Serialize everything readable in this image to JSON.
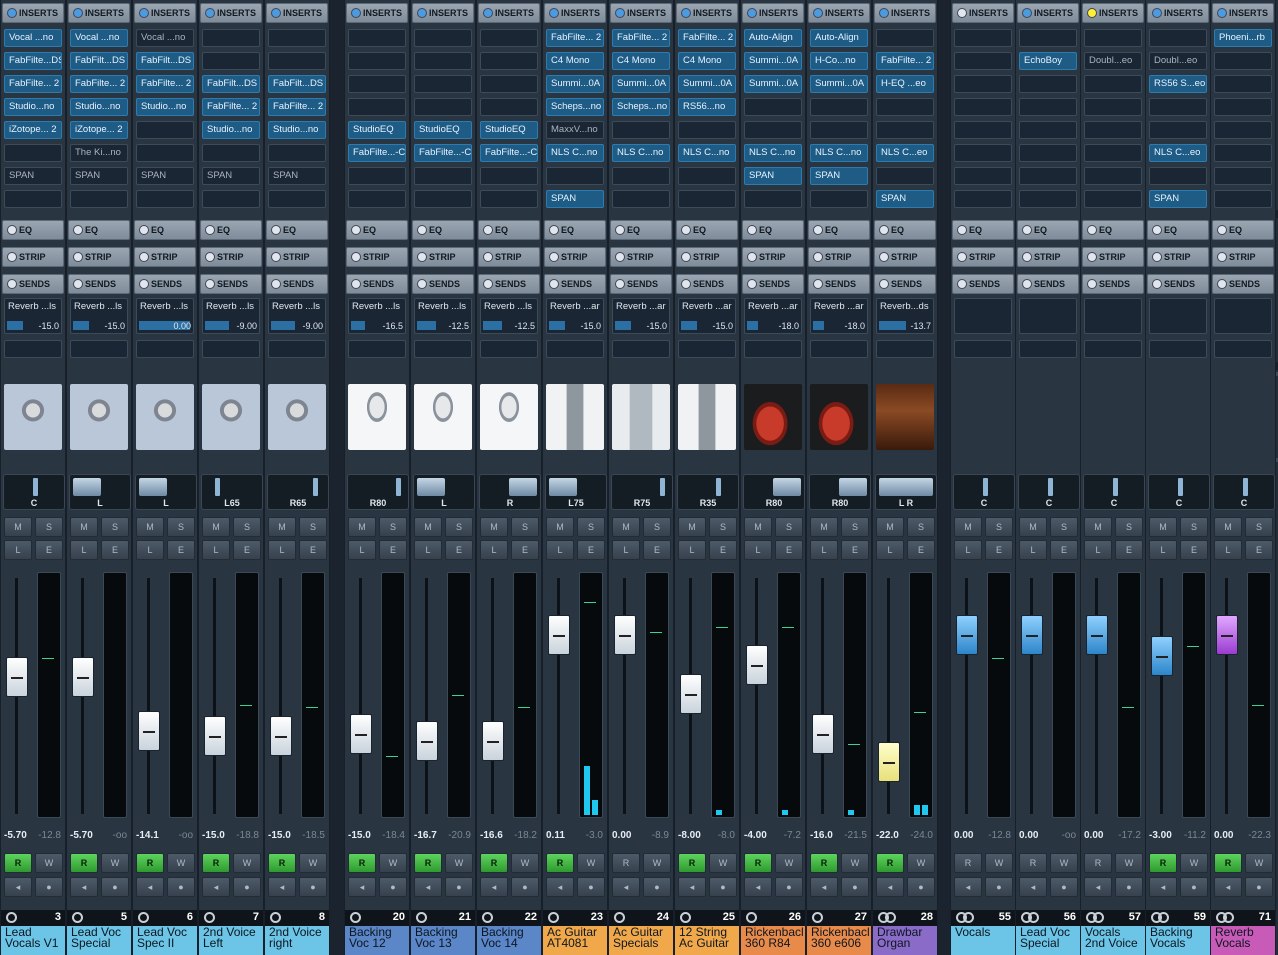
{
  "colors": {
    "rec_green": "#4ec24e",
    "insert_blue": "#1f5c85",
    "accent_yellow": "#ffee33"
  },
  "labels": {
    "inserts": "INSERTS",
    "eq": "EQ",
    "strip": "STRIP",
    "sends": "SENDS",
    "mute": "M",
    "solo": "S",
    "listen": "L",
    "edit": "E",
    "read": "R",
    "write": "W"
  },
  "strips": [
    {
      "num": "3",
      "name": "Lead Vocals V1",
      "color": "#6cc4e6",
      "inserts": [
        "Vocal ...no",
        "FabFilte...DS",
        "FabFilte... 2",
        "Studio...no",
        "iZotope... 2",
        "",
        "SPAN",
        ""
      ],
      "insert_on": [
        1,
        1,
        1,
        1,
        1,
        0,
        0,
        0
      ],
      "send_name": "Reverb ...ls",
      "send_val": "-15.0",
      "send_frac": 0.3,
      "pan": "C",
      "pan_pos": 0.5,
      "pan_mode": "ind",
      "vol": "-5.70",
      "peak": "-12.8",
      "fader": 0.42,
      "cap": "white",
      "rec": true,
      "pic": "mic-large",
      "link": false,
      "meter_peak": 0.65
    },
    {
      "num": "5",
      "name": "Lead Voc Special",
      "color": "#6cc4e6",
      "inserts": [
        "Vocal ...no",
        "FabFilt...DS",
        "FabFilte... 2",
        "Studio...no",
        "iZotope... 2",
        "The Ki...no",
        "SPAN",
        ""
      ],
      "insert_on": [
        1,
        1,
        1,
        1,
        1,
        0,
        0,
        0
      ],
      "send_name": "Reverb ...ls",
      "send_val": "-15.0",
      "send_frac": 0.3,
      "pan": "L",
      "pan_pos": 0.0,
      "pan_mode": "wideL",
      "vol": "-5.70",
      "peak": "-oo",
      "fader": 0.42,
      "cap": "white",
      "rec": true,
      "pic": "mic-large",
      "link": false,
      "meter_peak": 0.0
    },
    {
      "num": "6",
      "name": "Lead Voc Spec II",
      "color": "#6cc4e6",
      "inserts": [
        "Vocal ...no",
        "FabFilt...DS",
        "FabFilte... 2",
        "Studio...no",
        "",
        "",
        "SPAN",
        ""
      ],
      "insert_on": [
        0,
        1,
        1,
        1,
        0,
        0,
        0,
        0
      ],
      "send_name": "Reverb ...ls",
      "send_val": "0.00",
      "send_frac": 0.95,
      "pan": "L",
      "pan_pos": 0.0,
      "pan_mode": "wideL",
      "vol": "-14.1",
      "peak": "-oo",
      "fader": 0.65,
      "cap": "white",
      "rec": true,
      "pic": "mic-large",
      "link": false,
      "meter_peak": 0.0
    },
    {
      "num": "7",
      "name": "2nd Voice Left",
      "color": "#6cc4e6",
      "inserts": [
        "",
        "",
        "FabFilt...DS",
        "FabFilte... 2",
        "Studio...no",
        "",
        "SPAN",
        ""
      ],
      "insert_on": [
        0,
        0,
        1,
        1,
        1,
        0,
        0,
        0
      ],
      "send_name": "Reverb ...ls",
      "send_val": "-9.00",
      "send_frac": 0.45,
      "pan": "L65",
      "pan_pos": 0.18,
      "pan_mode": "ind",
      "vol": "-15.0",
      "peak": "-18.8",
      "fader": 0.67,
      "cap": "white",
      "rec": true,
      "pic": "mic-large",
      "link": false,
      "meter_peak": 0.46
    },
    {
      "num": "8",
      "name": "2nd Voice right",
      "color": "#6cc4e6",
      "inserts": [
        "",
        "",
        "FabFilt...DS",
        "FabFilte... 2",
        "Studio...no",
        "",
        "SPAN",
        ""
      ],
      "insert_on": [
        0,
        0,
        1,
        1,
        1,
        0,
        0,
        0
      ],
      "send_name": "Reverb ...ls",
      "send_val": "-9.00",
      "send_frac": 0.45,
      "pan": "R65",
      "pan_pos": 0.82,
      "pan_mode": "ind",
      "vol": "-15.0",
      "peak": "-18.5",
      "fader": 0.67,
      "cap": "white",
      "rec": true,
      "pic": "mic-large",
      "link": false,
      "meter_peak": 0.45
    },
    {
      "num": "20",
      "name": "Backing Voc 12",
      "color": "#5b86c8",
      "inserts": [
        "",
        "",
        "",
        "",
        "StudioEQ",
        "FabFilte...-C",
        "",
        ""
      ],
      "insert_on": [
        0,
        0,
        0,
        0,
        1,
        1,
        0,
        0
      ],
      "send_name": "Reverb ...ls",
      "send_val": "-16.5",
      "send_frac": 0.25,
      "pan": "R80",
      "pan_pos": 0.88,
      "pan_mode": "ind",
      "vol": "-15.0",
      "peak": "-18.4",
      "fader": 0.66,
      "cap": "white",
      "rec": true,
      "pic": "mic-condenser",
      "link": false,
      "meter_peak": 0.25
    },
    {
      "num": "21",
      "name": "Backing Voc 13",
      "color": "#5b86c8",
      "inserts": [
        "",
        "",
        "",
        "",
        "StudioEQ",
        "FabFilte...-C",
        "",
        ""
      ],
      "insert_on": [
        0,
        0,
        0,
        0,
        1,
        1,
        0,
        0
      ],
      "send_name": "Reverb ...ls",
      "send_val": "-12.5",
      "send_frac": 0.35,
      "pan": "L",
      "pan_pos": 0.0,
      "pan_mode": "wideL",
      "vol": "-16.7",
      "peak": "-20.9",
      "fader": 0.69,
      "cap": "white",
      "rec": true,
      "pic": "mic-condenser",
      "link": false,
      "meter_peak": 0.5
    },
    {
      "num": "22",
      "name": "Backing Voc 14",
      "color": "#5b86c8",
      "inserts": [
        "",
        "",
        "",
        "",
        "StudioEQ",
        "FabFilte...-C",
        "",
        ""
      ],
      "insert_on": [
        0,
        0,
        0,
        0,
        1,
        1,
        0,
        0
      ],
      "send_name": "Reverb ...ls",
      "send_val": "-12.5",
      "send_frac": 0.35,
      "pan": "R",
      "pan_pos": 1.0,
      "pan_mode": "wideR",
      "vol": "-16.6",
      "peak": "-18.2",
      "fader": 0.69,
      "cap": "white",
      "rec": true,
      "pic": "mic-condenser",
      "link": false,
      "meter_peak": 0.45
    },
    {
      "num": "23",
      "name": "Ac Guitar AT4081",
      "color": "#f0a84a",
      "inserts": [
        "FabFilte... 2",
        "C4 Mono",
        "Summi...0A",
        "Scheps...no",
        "MaxxV...no",
        "NLS C...no",
        "",
        "SPAN"
      ],
      "insert_on": [
        1,
        1,
        1,
        1,
        0,
        1,
        0,
        1
      ],
      "send_name": "Reverb ...ar",
      "send_val": "-15.0",
      "send_frac": 0.3,
      "pan": "L75",
      "pan_pos": 0.12,
      "pan_mode": "wideL",
      "vol": "0.11",
      "peak": "-3.0",
      "fader": 0.24,
      "cap": "white",
      "rec": true,
      "pic": "ribbon",
      "link": false,
      "meter_peak": 0.88,
      "meter_level": [
        0.2,
        0.06
      ]
    },
    {
      "num": "24",
      "name": "Ac Guitar Specials",
      "color": "#f0a84a",
      "inserts": [
        "FabFilte... 2",
        "C4 Mono",
        "Summi...0A",
        "Scheps...no",
        "",
        "NLS C...no",
        "",
        ""
      ],
      "insert_on": [
        1,
        1,
        1,
        1,
        0,
        1,
        0,
        0
      ],
      "send_name": "Reverb ...ar",
      "send_val": "-15.0",
      "send_frac": 0.3,
      "pan": "R75",
      "pan_pos": 0.88,
      "pan_mode": "ind",
      "vol": "0.00",
      "peak": "-8.9",
      "fader": 0.24,
      "cap": "white",
      "rec": false,
      "pic": "mic-silver",
      "link": false,
      "meter_peak": 0.76
    },
    {
      "num": "25",
      "name": "12 String Ac Guitar",
      "color": "#f0a84a",
      "inserts": [
        "FabFilte... 2",
        "C4 Mono",
        "Summi...0A",
        "RS56...no",
        "",
        "NLS C...no",
        "",
        ""
      ],
      "insert_on": [
        1,
        1,
        1,
        1,
        0,
        1,
        0,
        0
      ],
      "send_name": "Reverb ...ar",
      "send_val": "-15.0",
      "send_frac": 0.3,
      "pan": "R35",
      "pan_pos": 0.68,
      "pan_mode": "ind",
      "vol": "-8.00",
      "peak": "-8.0",
      "fader": 0.49,
      "cap": "white",
      "rec": true,
      "pic": "ribbon",
      "link": false,
      "meter_peak": 0.78,
      "meter_level": [
        0.02
      ]
    },
    {
      "num": "26",
      "name": "Rickenbacl 360 R84",
      "color": "#e88a4a",
      "inserts": [
        "Auto-Align",
        "Summi...0A",
        "Summi...0A",
        "",
        "",
        "NLS C...no",
        "SPAN",
        ""
      ],
      "insert_on": [
        1,
        1,
        1,
        0,
        0,
        1,
        1,
        0
      ],
      "send_name": "Reverb ...ar",
      "send_val": "-18.0",
      "send_frac": 0.2,
      "pan": "R80",
      "pan_pos": 0.9,
      "pan_mode": "wideR",
      "vol": "-4.00",
      "peak": "-7.2",
      "fader": 0.37,
      "cap": "white",
      "rec": true,
      "pic": "guitar",
      "link": false,
      "meter_peak": 0.78,
      "meter_level": [
        0.02
      ]
    },
    {
      "num": "27",
      "name": "Rickenbacl 360 e606",
      "color": "#e88a4a",
      "inserts": [
        "Auto-Align",
        "H-Co...no",
        "Summi...0A",
        "",
        "",
        "NLS C...no",
        "SPAN",
        ""
      ],
      "insert_on": [
        1,
        1,
        1,
        0,
        0,
        1,
        1,
        0
      ],
      "send_name": "Reverb ...ar",
      "send_val": "-18.0",
      "send_frac": 0.2,
      "pan": "R80",
      "pan_pos": 0.9,
      "pan_mode": "wideR",
      "vol": "-16.0",
      "peak": "-21.5",
      "fader": 0.66,
      "cap": "white",
      "rec": true,
      "pic": "guitar",
      "link": false,
      "meter_peak": 0.3,
      "meter_level": [
        0.02
      ]
    },
    {
      "num": "28",
      "name": "Drawbar Organ",
      "color": "#8a6cc8",
      "inserts": [
        "",
        "FabFilte... 2",
        "H-EQ ...eo",
        "",
        "",
        "NLS C...eo",
        "",
        "SPAN"
      ],
      "insert_on": [
        0,
        1,
        1,
        0,
        0,
        1,
        0,
        1
      ],
      "send_name": "Reverb...ds",
      "send_val": "-13.7",
      "send_frac": 0.5,
      "pan": "L R",
      "pan_pos": 0.5,
      "pan_mode": "stereo",
      "vol": "-22.0",
      "peak": "-24.0",
      "fader": 0.78,
      "cap": "yellow",
      "rec": true,
      "pic": "organ",
      "link": true,
      "meter_peak": 0.43,
      "meter_level": [
        0.04,
        0.04
      ]
    },
    {
      "num": "55",
      "name": "Vocals",
      "color": "#6cc4e6",
      "inserts": [
        "",
        "",
        "",
        "",
        "",
        "",
        "",
        ""
      ],
      "insert_on": [
        0,
        0,
        0,
        0,
        0,
        0,
        0,
        0
      ],
      "send_name": "",
      "send_val": "",
      "send_frac": 0,
      "pan": "C",
      "pan_pos": 0.5,
      "pan_mode": "ind",
      "vol": "0.00",
      "peak": "-12.8",
      "fader": 0.24,
      "cap": "blue",
      "rec": false,
      "pic": "",
      "link": true,
      "meter_peak": 0.65
    },
    {
      "num": "56",
      "name": "Lead Voc Special",
      "color": "#6cc4e6",
      "inserts": [
        "",
        "EchoBoy",
        "",
        "",
        "",
        "",
        "",
        ""
      ],
      "insert_on": [
        0,
        1,
        0,
        0,
        0,
        0,
        0,
        0
      ],
      "send_name": "",
      "send_val": "",
      "send_frac": 0,
      "pan": "C",
      "pan_pos": 0.5,
      "pan_mode": "ind",
      "vol": "0.00",
      "peak": "-oo",
      "fader": 0.24,
      "cap": "blue",
      "rec": false,
      "pic": "",
      "link": true,
      "meter_peak": 0.0
    },
    {
      "num": "57",
      "name": "Vocals 2nd Voice",
      "color": "#6cc4e6",
      "inserts": [
        "",
        "Doubl...eo",
        "",
        "",
        "",
        "",
        "",
        ""
      ],
      "insert_on": [
        0,
        0,
        0,
        0,
        0,
        0,
        0,
        0
      ],
      "send_name": "",
      "send_val": "",
      "send_frac": 0,
      "pan": "C",
      "pan_pos": 0.5,
      "pan_mode": "ind",
      "vol": "0.00",
      "peak": "-17.2",
      "fader": 0.24,
      "cap": "blue",
      "rec": false,
      "pic": "",
      "link": true,
      "meter_peak": 0.45
    },
    {
      "num": "59",
      "name": "Backing Vocals",
      "color": "#6cc4e6",
      "inserts": [
        "",
        "Doubl...eo",
        "RS56 S...eo",
        "",
        "",
        "NLS C...eo",
        "",
        "SPAN"
      ],
      "insert_on": [
        0,
        0,
        1,
        0,
        0,
        1,
        0,
        1
      ],
      "send_name": "",
      "send_val": "",
      "send_frac": 0,
      "pan": "C",
      "pan_pos": 0.5,
      "pan_mode": "ind",
      "vol": "-3.00",
      "peak": "-11.2",
      "fader": 0.33,
      "cap": "blue",
      "rec": true,
      "pic": "",
      "link": true,
      "meter_peak": 0.7
    },
    {
      "num": "71",
      "name": "Reverb Vocals",
      "color": "#c85ab8",
      "inserts": [
        "Phoeni...rb",
        "",
        "",
        "",
        "",
        "",
        "",
        ""
      ],
      "insert_on": [
        1,
        0,
        0,
        0,
        0,
        0,
        0,
        0
      ],
      "send_name": "",
      "send_val": "",
      "send_frac": 0,
      "pan": "C",
      "pan_pos": 0.5,
      "pan_mode": "ind",
      "vol": "0.00",
      "peak": "-22.3",
      "fader": 0.24,
      "cap": "purple",
      "rec": true,
      "pic": "",
      "link": true,
      "meter_peak": 0.46
    }
  ]
}
